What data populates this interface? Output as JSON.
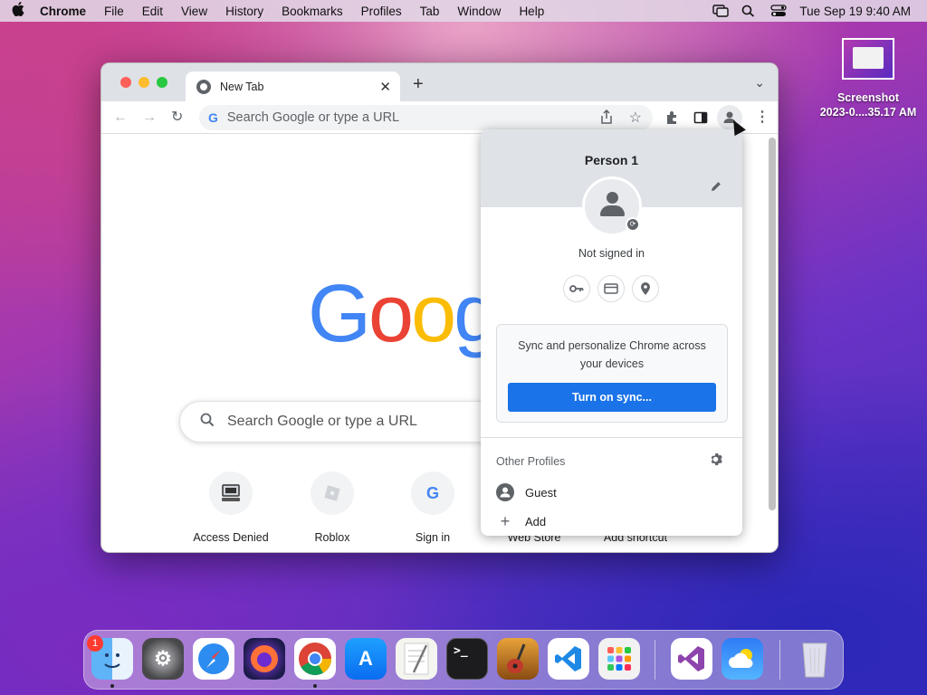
{
  "menubar": {
    "apple": "",
    "app_name": "Chrome",
    "items": [
      "File",
      "Edit",
      "View",
      "History",
      "Bookmarks",
      "Profiles",
      "Tab",
      "Window",
      "Help"
    ],
    "datetime": "Tue Sep 19  9:40 AM"
  },
  "desktop": {
    "screenshot_label_1": "Screenshot",
    "screenshot_label_2": "2023-0....35.17 AM"
  },
  "browser": {
    "tab_title": "New Tab",
    "tab_close": "✕",
    "new_tab": "+",
    "tab_menu": "⌄",
    "omnibox_placeholder": "Search Google or type a URL",
    "page_search_placeholder": "Search Google or type a URL",
    "logo_letters": [
      "G",
      "o",
      "o",
      "g"
    ],
    "logo_colors": [
      "#4285f4",
      "#ea4335",
      "#fbbc05",
      "#4285f4"
    ],
    "shortcuts": [
      "Access Denied",
      "Roblox",
      "Sign in",
      "Web Store",
      "Add shortcut"
    ]
  },
  "profile_popup": {
    "name": "Person 1",
    "status": "Not signed in",
    "sync_text": "Sync and personalize Chrome across your devices",
    "sync_button": "Turn on sync...",
    "other_profiles_label": "Other Profiles",
    "profiles": [
      "Guest"
    ],
    "add_label": "Add"
  },
  "dock": {
    "settings_badge": "1"
  },
  "colors": {
    "accent": "#1a73e8",
    "popup_header": "#dfe2e7",
    "tabstrip": "#dee1e6"
  }
}
